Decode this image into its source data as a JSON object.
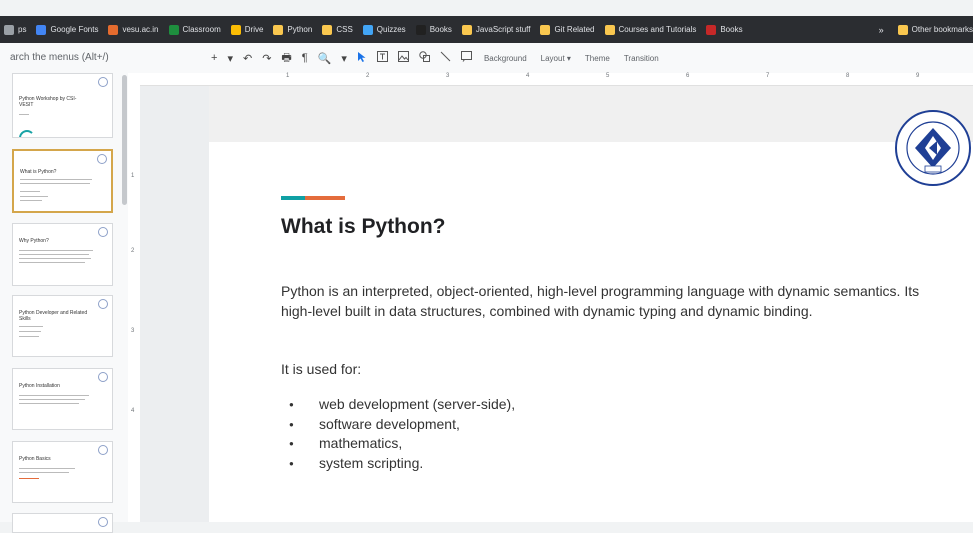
{
  "bookmarks": [
    {
      "label": "ps",
      "color": "#9aa0a6"
    },
    {
      "label": "Google Fonts",
      "color": "#4285f4"
    },
    {
      "label": "vesu.ac.in",
      "color": "#e56b2e"
    },
    {
      "label": "Classroom",
      "color": "#1e8e3e"
    },
    {
      "label": "Drive",
      "color": "#fbbc04"
    },
    {
      "label": "Python",
      "color": "#f9c74f"
    },
    {
      "label": "CSS",
      "color": "#f9c74f"
    },
    {
      "label": "Quizzes",
      "color": "#42a5f5"
    },
    {
      "label": "Books",
      "color": "#212121"
    },
    {
      "label": "JavaScript stuff",
      "color": "#f9c74f"
    },
    {
      "label": "Git Related",
      "color": "#f9c74f"
    },
    {
      "label": "Courses and Tutorials",
      "color": "#f9c74f"
    },
    {
      "label": "Books",
      "color": "#c62828"
    }
  ],
  "bookmarks_more": "»",
  "bookmarks_other": "Other bookmarks",
  "menu_search": "arch the menus (Alt+/)",
  "toolbar": {
    "icons": [
      "+",
      "▾",
      "↶",
      "↷",
      "🖶",
      "¶",
      "🔍",
      "▾"
    ],
    "background": "Background",
    "layout": "Layout ▾",
    "theme": "Theme",
    "transition": "Transition"
  },
  "ruler": [
    "1",
    "2",
    "3",
    "4",
    "5",
    "6",
    "7",
    "8",
    "9"
  ],
  "vruler": [
    "1",
    "2",
    "3",
    "4"
  ],
  "thumbs": [
    {
      "title": "Python Workshop by CSI-VESIT"
    },
    {
      "title": "What is Python?"
    },
    {
      "title": "Why Python?"
    },
    {
      "title": "Python Developer and Related Skills"
    },
    {
      "title": "Python Installation"
    },
    {
      "title": "Python Basics"
    }
  ],
  "slide": {
    "title": "What is Python?",
    "paragraph": "Python is an interpreted, object-oriented, high-level programming language with dynamic semantics. Its high-level built in data structures, combined with dynamic typing and dynamic binding.",
    "used_for": "It is used for:",
    "bullets": [
      "web development (server-side),",
      "software development,",
      "mathematics,",
      "system scripting."
    ]
  },
  "colors": {
    "accent_teal": "#10a0a4",
    "accent_orange": "#e46c3c",
    "seal_blue": "#1f3f95"
  }
}
